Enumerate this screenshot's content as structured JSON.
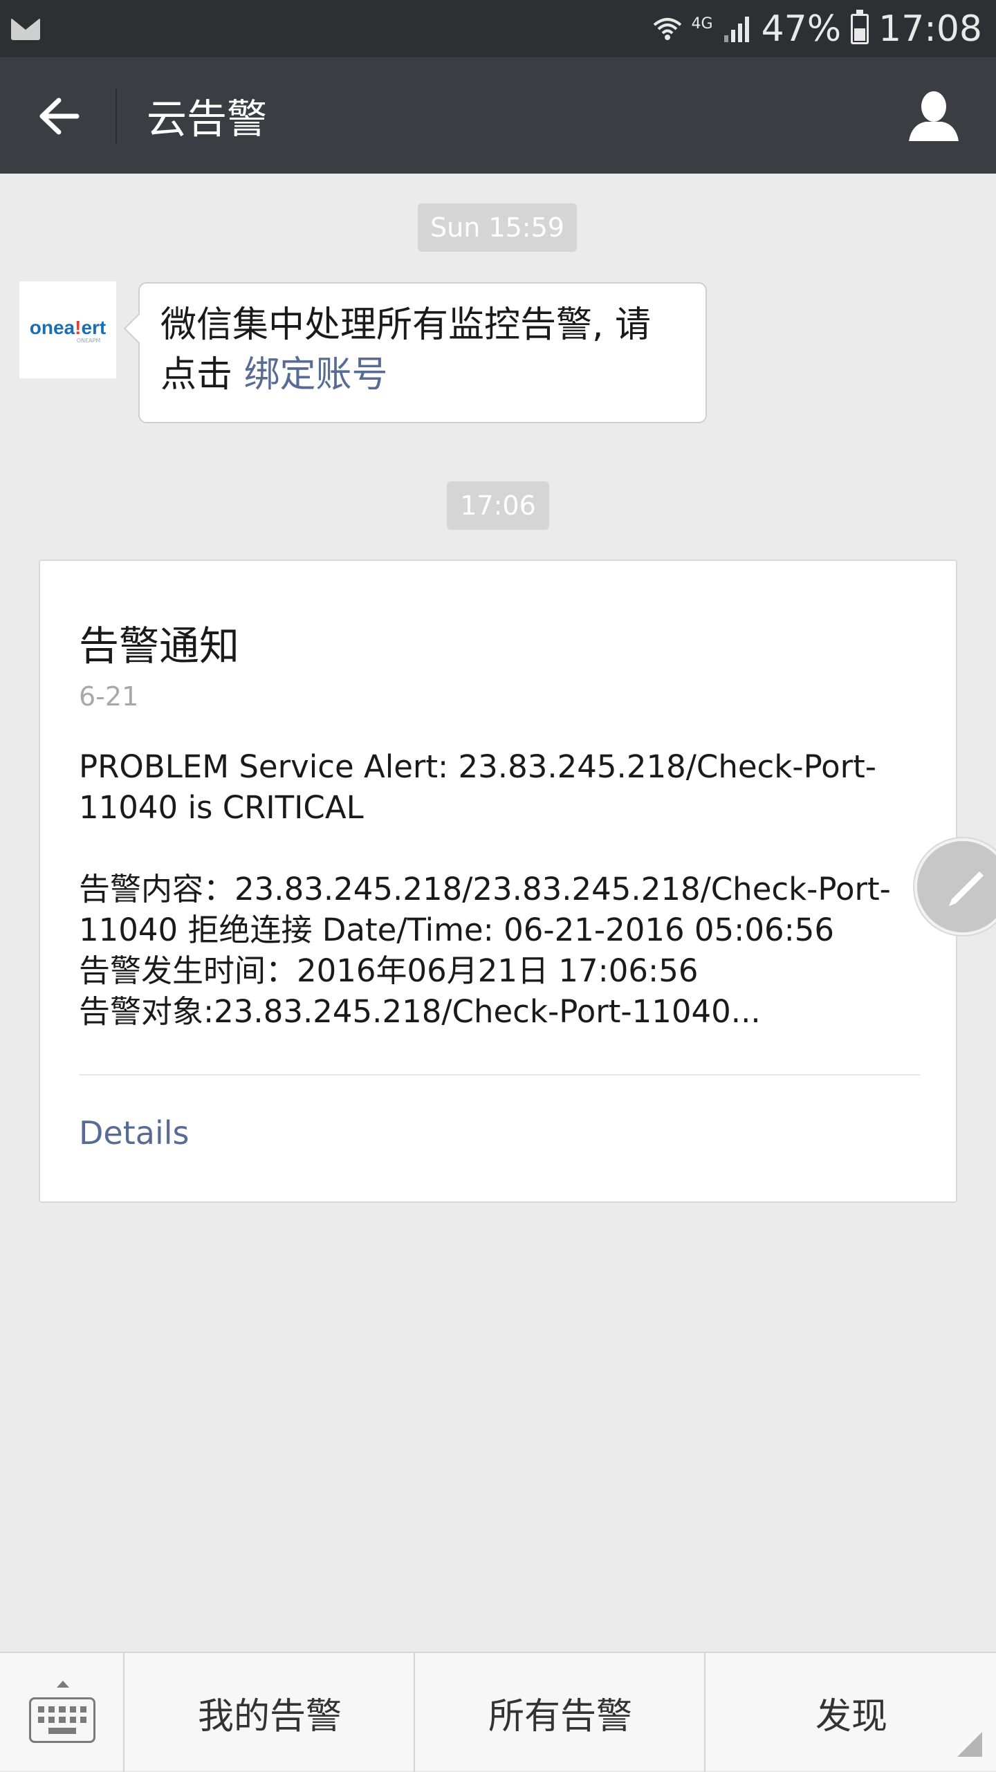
{
  "status_bar": {
    "network": "4G",
    "battery": "47%",
    "time": "17:08",
    "icons": [
      "mail-icon",
      "wifi-icon",
      "signal-icon",
      "battery-icon"
    ]
  },
  "header": {
    "title": "云告警",
    "back_icon": "arrow-left-icon",
    "profile_icon": "person-icon"
  },
  "chat": {
    "timestamps": [
      "Sun 15:59",
      "17:06"
    ],
    "sender_logo": "onealert",
    "sender_logo_sub": "ONEAPM",
    "message": {
      "text": "微信集中处理所有监控告警, 请点击 ",
      "link": "绑定账号"
    },
    "card": {
      "title": "告警通知",
      "date": "6-21",
      "lines": [
        "PROBLEM Service Alert: 23.83.245.218/Check-Port-11040 is CRITICAL",
        "",
        "告警内容：23.83.245.218/23.83.245.218/Check-Port-11040 拒绝连接 Date/Time: 06-21-2016 05:06:56",
        "告警发生时间：2016年06月21日 17:06:56",
        "告警对象:23.83.245.218/Check-Port-11040..."
      ],
      "details_label": "Details"
    }
  },
  "bottom_menu": {
    "keyboard_icon": "keyboard-icon",
    "items": [
      "我的告警",
      "所有告警",
      "发现"
    ]
  },
  "colors": {
    "status_bar": "#2d2f33",
    "title_bar": "#3b3d42",
    "background": "#ebebeb",
    "link": "#576b95"
  }
}
